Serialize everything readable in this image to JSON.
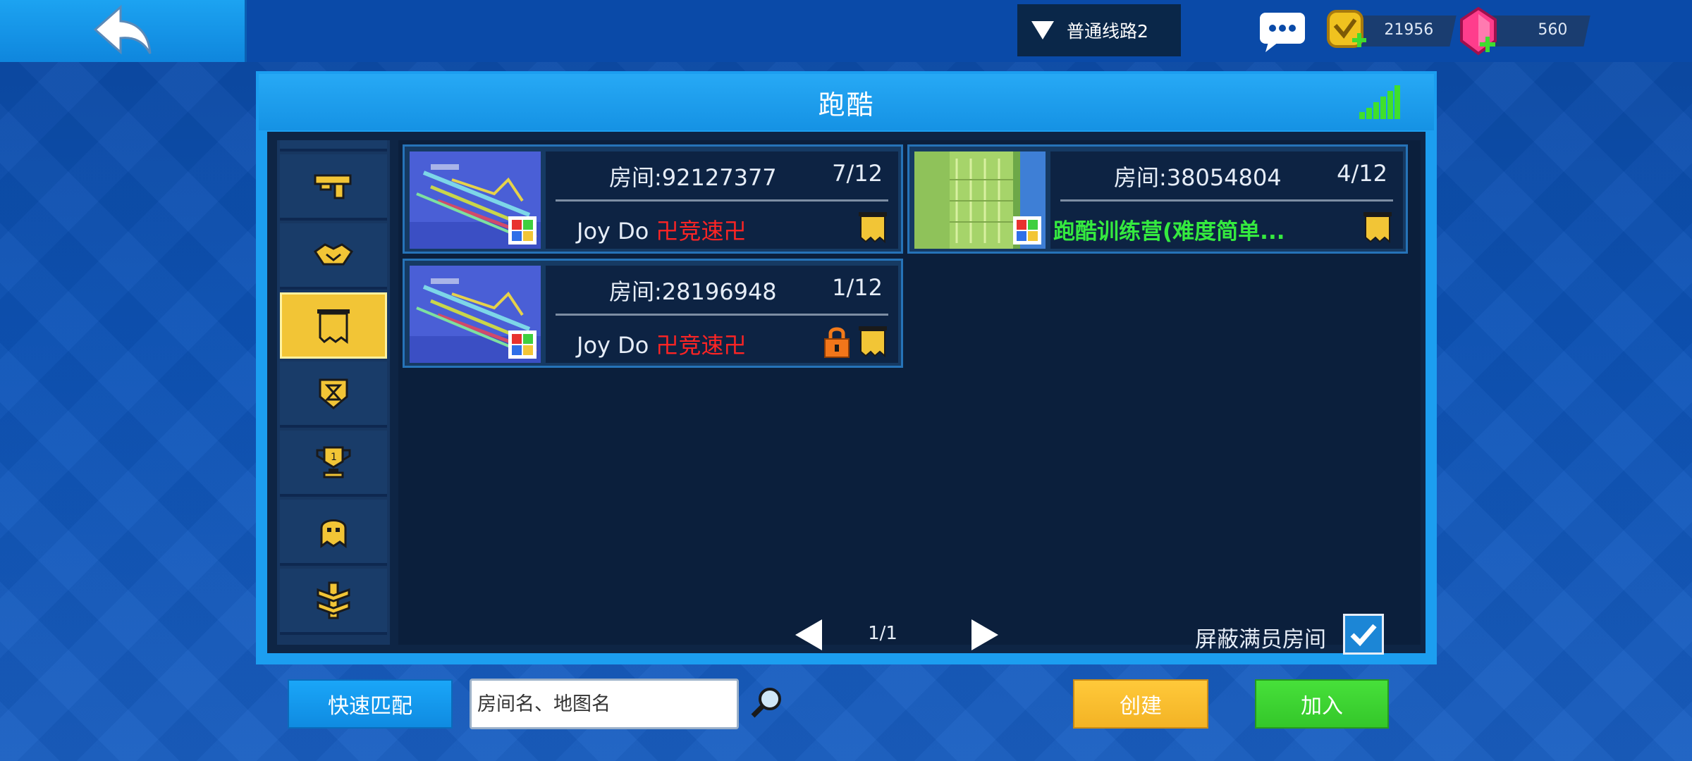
{
  "topbar": {
    "server": "普通线路2",
    "coins": "21956",
    "gems": "560"
  },
  "panel": {
    "title": "跑酷"
  },
  "sidebar": {
    "items": [
      {
        "icon": "gun-icon"
      },
      {
        "icon": "handshake-icon"
      },
      {
        "icon": "banner-icon",
        "active": true
      },
      {
        "icon": "hourglass-badge-icon"
      },
      {
        "icon": "trophy-icon"
      },
      {
        "icon": "ghost-icon"
      },
      {
        "icon": "chevron-rank-icon"
      }
    ]
  },
  "rooms": [
    {
      "room": "房间:92127377",
      "count": "7/12",
      "owner": "Joy Do",
      "tag": "卍竞速卍",
      "locked": false
    },
    {
      "room": "房间:38054804",
      "count": "4/12",
      "name": "跑酷训练营(难度简单...",
      "locked": false
    },
    {
      "room": "房间:28196948",
      "count": "1/12",
      "owner": "Joy Do",
      "tag": "卍竞速卍",
      "locked": true
    }
  ],
  "pager": {
    "label": "1/1"
  },
  "filters": {
    "hide_full_label": "屏蔽满员房间"
  },
  "bottom": {
    "quick_match": "快速匹配",
    "search_placeholder": "房间名、地图名",
    "create": "创建",
    "join": "加入"
  },
  "colors": {
    "accent_blue": "#1c9ef0",
    "create_yellow": "#ffc93a",
    "join_green": "#47e03a",
    "tag_red": "#ff2424",
    "name_green": "#35ea3f"
  }
}
